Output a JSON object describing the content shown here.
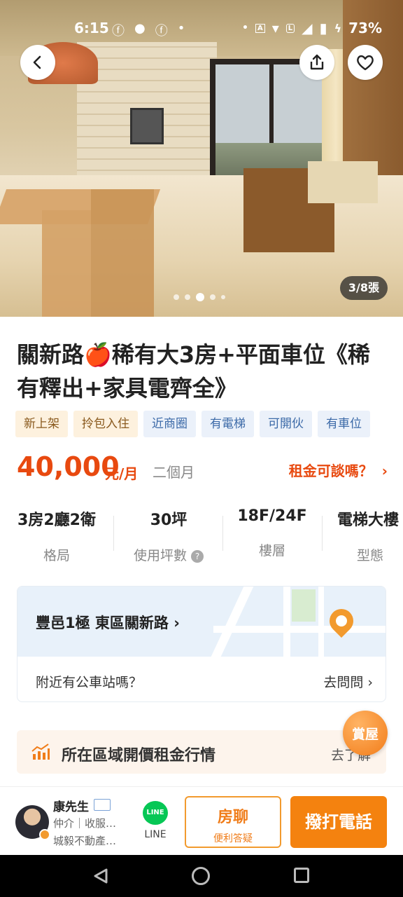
{
  "status_bar": {
    "time": "6:15",
    "battery": "73%",
    "icons": [
      "facebook-icon",
      "chat-icon",
      "facebook-icon",
      "dot-icon",
      "dot-icon",
      "auto-icon",
      "wifi-icon",
      "lte-icon",
      "signal-icon",
      "battery-icon",
      "charging-icon"
    ]
  },
  "gallery": {
    "counter": "3/8張",
    "dots_total": 5,
    "dots_active_index": 2
  },
  "listing": {
    "title": "關新路🍎稀有大3房+平面車位《稀有釋出+家具電齊全》",
    "tags": [
      {
        "label": "新上架",
        "style": "warm"
      },
      {
        "label": "拎包入住",
        "style": "warm"
      },
      {
        "label": "近商圈",
        "style": "cool"
      },
      {
        "label": "有電梯",
        "style": "cool"
      },
      {
        "label": "可開伙",
        "style": "cool"
      },
      {
        "label": "有車位",
        "style": "cool"
      }
    ],
    "price": "40,000",
    "price_unit": "元/月",
    "lease": "二個月",
    "negotiate": "租金可談嗎？"
  },
  "specs": [
    {
      "value": "3房2廳2衛",
      "label": "格局"
    },
    {
      "value": "30坪",
      "label": "使用坪數"
    },
    {
      "value": "18F/24F",
      "label": "樓層"
    },
    {
      "value": "電梯大樓",
      "label": "型態"
    }
  ],
  "map": {
    "address": "豐邑1極 東區關新路",
    "bus_question": "附近有公車站嗎？",
    "ask": "去問問"
  },
  "market": {
    "text": "所在區域開價租金行情",
    "go": "去了解"
  },
  "fab": {
    "label": "賞屋"
  },
  "agent": {
    "name": "康先生",
    "role": "仲介｜收服…",
    "company": "城毅不動產…",
    "line_label": "LINE",
    "line_logo": "LINE"
  },
  "actions": {
    "chat_main": "房聊",
    "chat_sub": "便利答疑",
    "call": "撥打電話"
  },
  "colors": {
    "accent": "#f4820f",
    "price": "#e8490f",
    "tag_warm_bg": "#fdf1de",
    "tag_cool_bg": "#ebf1fa",
    "line_green": "#06c755"
  }
}
